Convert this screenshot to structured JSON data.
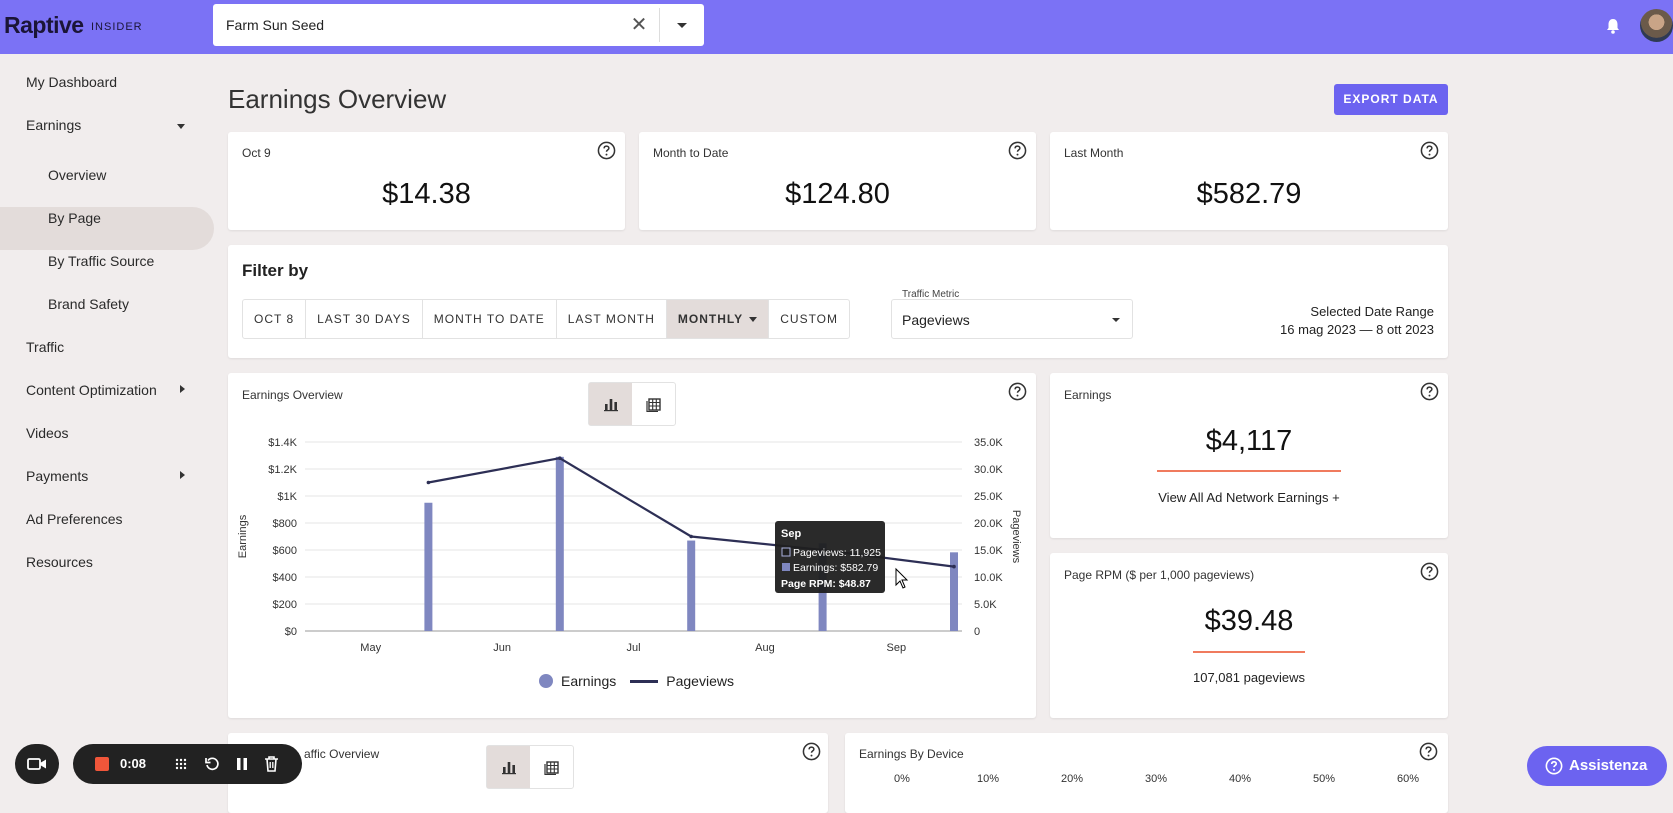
{
  "topbar": {
    "logo": "Raptive",
    "logo_sub": "INSIDER",
    "site_value": "Farm Sun Seed",
    "accent": "#7b72f5"
  },
  "sidebar": {
    "items": [
      {
        "label": "My Dashboard"
      },
      {
        "label": "Earnings"
      },
      {
        "label": "Overview"
      },
      {
        "label": "By Page"
      },
      {
        "label": "By Traffic Source"
      },
      {
        "label": "Brand Safety"
      },
      {
        "label": "Traffic"
      },
      {
        "label": "Content Optimization"
      },
      {
        "label": "Videos"
      },
      {
        "label": "Payments"
      },
      {
        "label": "Ad Preferences"
      },
      {
        "label": "Resources"
      }
    ]
  },
  "main": {
    "title": "Earnings Overview",
    "export_label": "EXPORT DATA",
    "stats": [
      {
        "label": "Oct 9",
        "value": "$14.38"
      },
      {
        "label": "Month to Date",
        "value": "$124.80"
      },
      {
        "label": "Last Month",
        "value": "$582.79"
      }
    ],
    "filter": {
      "title": "Filter by",
      "buttons": [
        "OCT 8",
        "LAST 30 DAYS",
        "MONTH TO DATE",
        "LAST MONTH",
        "MONTHLY",
        "CUSTOM"
      ],
      "metric_label": "Traffic Metric",
      "metric_value": "Pageviews",
      "range_label": "Selected Date Range",
      "range_value": "16 mag 2023 — 8 ott 2023"
    },
    "chart_card": {
      "title": "Earnings Overview"
    },
    "earnings_card": {
      "label": "Earnings",
      "value": "$4,117",
      "link": "View All Ad Network Earnings +"
    },
    "rpm_card": {
      "label": "Page RPM ($ per 1,000 pageviews)",
      "value": "$39.48",
      "sub": "107,081 pageviews"
    },
    "traffic_card": {
      "title": "Traffic Overview",
      "title_visible": "affic Overview"
    },
    "device_card": {
      "title": "Earnings By Device",
      "ticks": [
        "0%",
        "10%",
        "20%",
        "30%",
        "40%",
        "50%",
        "60%"
      ]
    }
  },
  "chart_data": {
    "type": "bar",
    "categories": [
      "May",
      "Jun",
      "Jul",
      "Aug",
      "Sep"
    ],
    "series": [
      {
        "name": "Earnings",
        "type": "bar",
        "axis": "left",
        "color": "#7f87c0",
        "values": [
          950,
          1290,
          670,
          650,
          582.79
        ]
      },
      {
        "name": "Pageviews",
        "type": "line",
        "axis": "right",
        "color": "#2d2f55",
        "values": [
          27500,
          32000,
          17500,
          15000,
          11925
        ]
      }
    ],
    "ylabel": "Earnings",
    "y2label": "Pageviews",
    "ylim": [
      0,
      1400
    ],
    "y2lim": [
      0,
      35000
    ],
    "yticks": [
      "$0",
      "$200",
      "$400",
      "$600",
      "$800",
      "$1K",
      "$1.2K",
      "$1.4K"
    ],
    "y2ticks": [
      "0",
      "5.0K",
      "10.0K",
      "15.0K",
      "20.0K",
      "25.0K",
      "30.0K",
      "35.0K"
    ],
    "grid": true,
    "legend": "bottom",
    "tooltip": {
      "title": "Sep",
      "lines": [
        "Pageviews: 11,925",
        "Earnings: $582.79",
        "Page RPM: $48.87"
      ]
    }
  },
  "recorder": {
    "time": "0:08"
  },
  "help": {
    "label": "Assistenza"
  }
}
